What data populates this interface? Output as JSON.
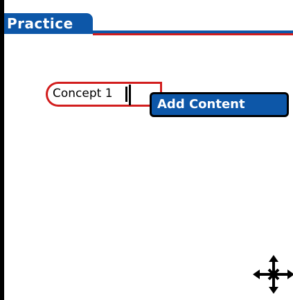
{
  "header": {
    "title": "Practice"
  },
  "canvas": {
    "concept_label": "Concept 1"
  },
  "context_menu": {
    "items": [
      {
        "label": "Add Content"
      }
    ]
  },
  "tools": {
    "move_icon": "move-icon"
  },
  "colors": {
    "title_bar": "#0d57a8",
    "accent_red": "#d21d1d",
    "menu_highlight": "#0d57a8"
  }
}
